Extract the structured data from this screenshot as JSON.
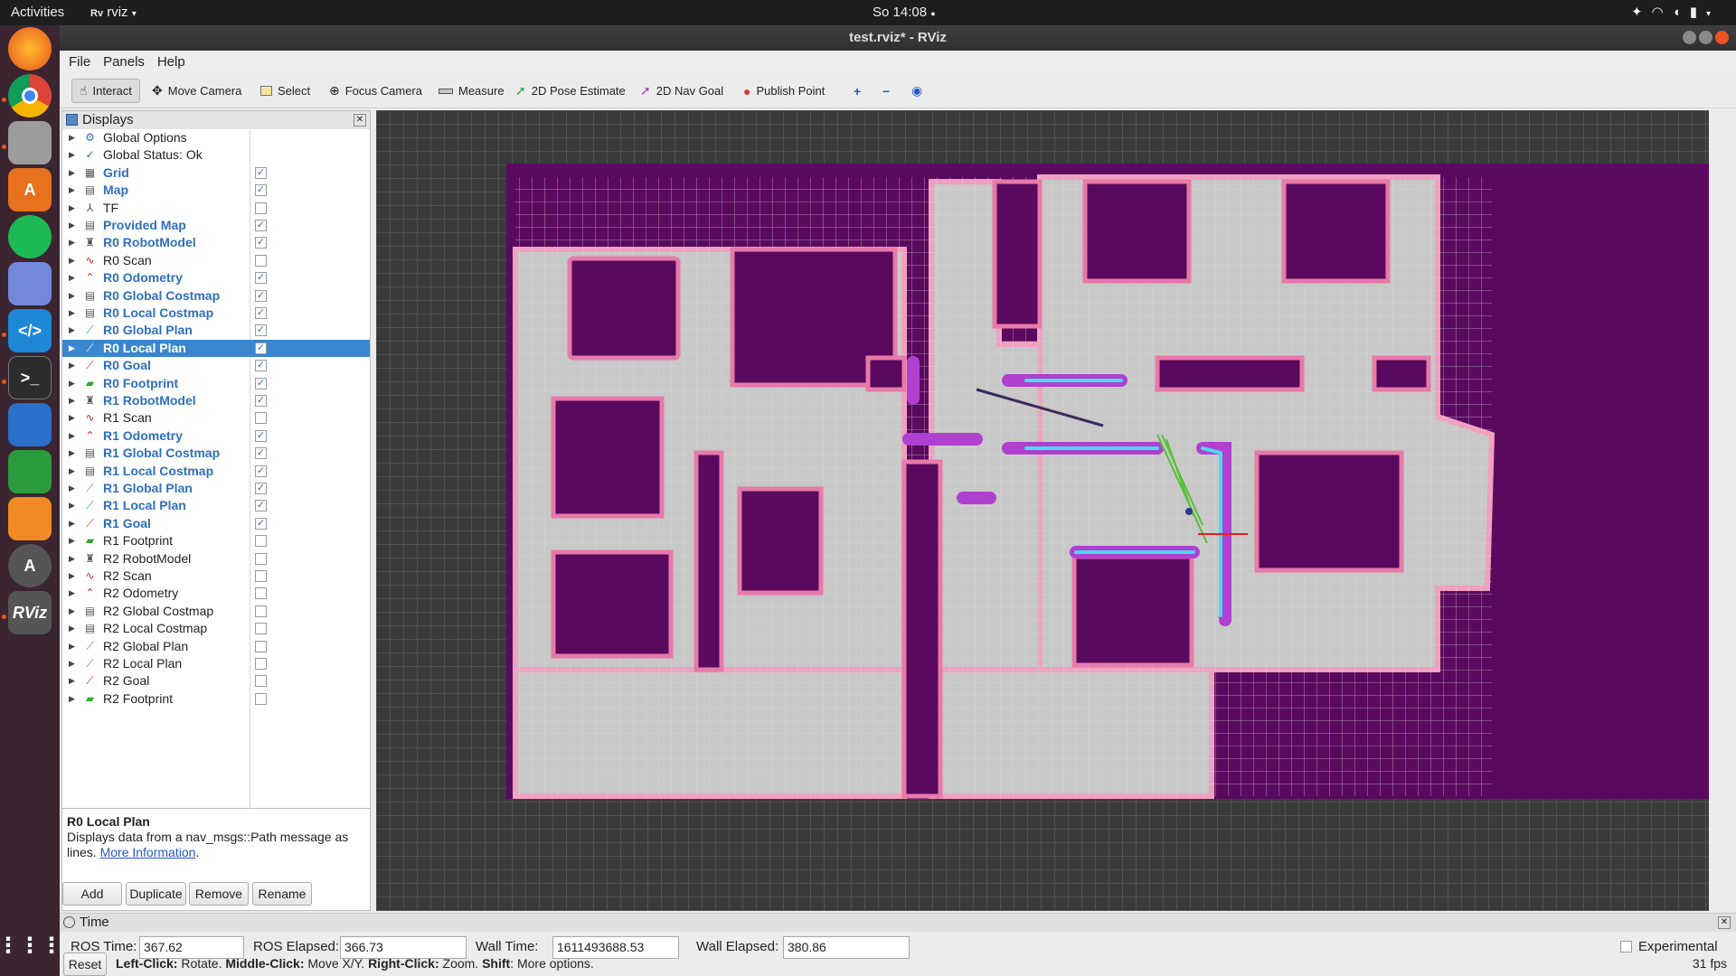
{
  "topbar": {
    "activities": "Activities",
    "app": "rviz",
    "clock": "So 14:08"
  },
  "window": {
    "title": "test.rviz* - RViz"
  },
  "menu": {
    "file": "File",
    "panels": "Panels",
    "help": "Help"
  },
  "toolbar": {
    "interact": "Interact",
    "move_camera": "Move Camera",
    "select": "Select",
    "focus_camera": "Focus Camera",
    "measure": "Measure",
    "pose_estimate": "2D Pose Estimate",
    "nav_goal": "2D Nav Goal",
    "publish_point": "Publish Point"
  },
  "displays": {
    "title": "Displays",
    "items": [
      {
        "label": "Global Options",
        "icon": "gear-icon",
        "bold": false,
        "checkbox": null
      },
      {
        "label": "Global Status: Ok",
        "icon": "check-icon",
        "bold": false,
        "checkbox": null
      },
      {
        "label": "Grid",
        "icon": "grid-icon",
        "bold": true,
        "checkbox": true
      },
      {
        "label": "Map",
        "icon": "map-icon",
        "bold": true,
        "checkbox": true
      },
      {
        "label": "TF",
        "icon": "tf-icon",
        "bold": false,
        "checkbox": false
      },
      {
        "label": "Provided Map",
        "icon": "map-icon",
        "bold": true,
        "checkbox": true
      },
      {
        "label": "R0 RobotModel",
        "icon": "robot-icon",
        "bold": true,
        "checkbox": true
      },
      {
        "label": "R0 Scan",
        "icon": "scan-icon",
        "bold": false,
        "checkbox": false
      },
      {
        "label": "R0 Odometry",
        "icon": "odometry-icon",
        "bold": true,
        "checkbox": true
      },
      {
        "label": "R0 Global Costmap",
        "icon": "map-icon",
        "bold": true,
        "checkbox": true
      },
      {
        "label": "R0 Local Costmap",
        "icon": "map-icon",
        "bold": true,
        "checkbox": true
      },
      {
        "label": "R0 Global Plan",
        "icon": "path-icon",
        "bold": true,
        "checkbox": true
      },
      {
        "label": "R0 Local Plan",
        "icon": "path-icon",
        "bold": true,
        "checkbox": true,
        "selected": true
      },
      {
        "label": "R0 Goal",
        "icon": "goal-icon",
        "bold": true,
        "checkbox": true
      },
      {
        "label": "R0 Footprint",
        "icon": "footprint-icon",
        "bold": true,
        "checkbox": true
      },
      {
        "label": "R1 RobotModel",
        "icon": "robot-icon",
        "bold": true,
        "checkbox": true
      },
      {
        "label": "R1 Scan",
        "icon": "scan-icon",
        "bold": false,
        "checkbox": false
      },
      {
        "label": "R1 Odometry",
        "icon": "odometry-icon",
        "bold": true,
        "checkbox": true
      },
      {
        "label": "R1 Global Costmap",
        "icon": "map-icon",
        "bold": true,
        "checkbox": true
      },
      {
        "label": "R1 Local Costmap",
        "icon": "map-icon",
        "bold": true,
        "checkbox": true
      },
      {
        "label": "R1 Global Plan",
        "icon": "path-icon",
        "bold": true,
        "checkbox": true
      },
      {
        "label": "R1 Local Plan",
        "icon": "path-icon",
        "bold": true,
        "checkbox": true
      },
      {
        "label": "R1 Goal",
        "icon": "goal-icon",
        "bold": true,
        "checkbox": true
      },
      {
        "label": "R1 Footprint",
        "icon": "footprint-icon",
        "bold": false,
        "checkbox": false
      },
      {
        "label": "R2 RobotModel",
        "icon": "robot-icon",
        "bold": false,
        "checkbox": false
      },
      {
        "label": "R2 Scan",
        "icon": "scan-icon",
        "bold": false,
        "checkbox": false
      },
      {
        "label": "R2 Odometry",
        "icon": "odometry-icon",
        "bold": false,
        "checkbox": false
      },
      {
        "label": "R2 Global Costmap",
        "icon": "map-icon",
        "bold": false,
        "checkbox": false
      },
      {
        "label": "R2 Local Costmap",
        "icon": "map-icon",
        "bold": false,
        "checkbox": false
      },
      {
        "label": "R2 Global Plan",
        "icon": "path-icon",
        "bold": false,
        "checkbox": false
      },
      {
        "label": "R2 Local Plan",
        "icon": "path-icon",
        "bold": false,
        "checkbox": false
      },
      {
        "label": "R2 Goal",
        "icon": "goal-icon",
        "bold": false,
        "checkbox": false
      },
      {
        "label": "R2 Footprint",
        "icon": "footprint-icon",
        "bold": false,
        "checkbox": false
      }
    ],
    "description_title": "R0 Local Plan",
    "description_text": "Displays data from a nav_msgs::Path message as lines.",
    "description_link": "More Information",
    "buttons": {
      "add": "Add",
      "duplicate": "Duplicate",
      "remove": "Remove",
      "rename": "Rename"
    }
  },
  "time": {
    "title": "Time",
    "ros_time_label": "ROS Time:",
    "ros_time": "367.62",
    "ros_elapsed_label": "ROS Elapsed:",
    "ros_elapsed": "366.73",
    "wall_time_label": "Wall Time:",
    "wall_time": "1611493688.53",
    "wall_elapsed_label": "Wall Elapsed:",
    "wall_elapsed": "380.86",
    "experimental": "Experimental"
  },
  "status": {
    "reset": "Reset",
    "left_click": "Left-Click:",
    "left_click_action": "Rotate.",
    "middle_click": "Middle-Click:",
    "middle_click_action": "Move X/Y.",
    "right_click": "Right-Click:",
    "right_click_action": "Zoom.",
    "shift": "Shift",
    "shift_action": "More options.",
    "fps": "31 fps"
  },
  "colors": {
    "costmap_lethal": "#5a0a5e",
    "free_space": "#c8c8c8",
    "inflation": "#f0a0c0",
    "selection": "#3a87cf",
    "plan": "#33cc33"
  }
}
